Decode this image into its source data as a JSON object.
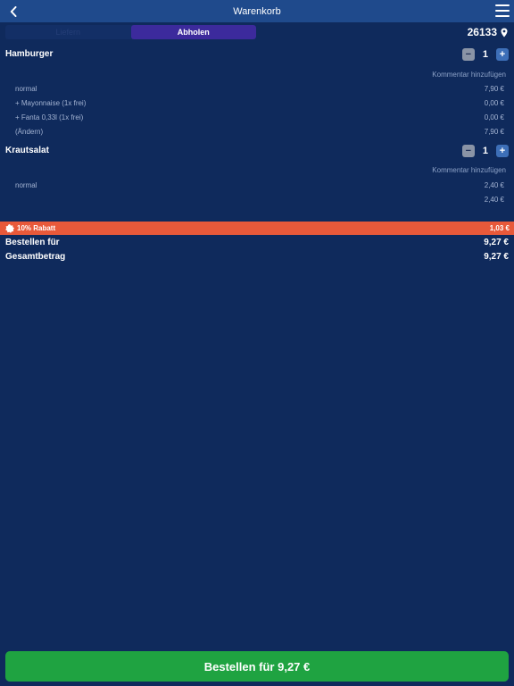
{
  "colors": {
    "background": "#0f2a5c",
    "navbar": "#1f4a8c",
    "segment_active": "#3c2a9c",
    "discount_bar": "#e8593a",
    "order_button": "#1fa341"
  },
  "header": {
    "title": "Warenkorb",
    "back_icon": "chevron-left-icon",
    "menu_icon": "hamburger-menu-icon"
  },
  "mode_tabs": [
    {
      "label": "Liefern",
      "active": false
    },
    {
      "label": "Abholen",
      "active": true
    }
  ],
  "location": {
    "zip": "26133",
    "icon": "map-pin-icon"
  },
  "cart_items": [
    {
      "name": "Hamburger",
      "quantity": "1",
      "comment_link": "Kommentar hinzufügen",
      "lines": [
        {
          "label": "normal",
          "price": "7,90 €"
        },
        {
          "label": "+ Mayonnaise (1x frei)",
          "price": "0,00 €"
        },
        {
          "label": "+ Fanta 0,33l (1x frei)",
          "price": "0,00 €"
        },
        {
          "label": "(Ändern)",
          "price": "7,90 €"
        }
      ]
    },
    {
      "name": "Krautsalat",
      "quantity": "1",
      "comment_link": "Kommentar hinzufügen",
      "lines": [
        {
          "label": "normal",
          "price": "2,40 €"
        }
      ],
      "subtotal": "2,40 €"
    }
  ],
  "discount": {
    "label": "10% Rabatt",
    "amount": "1,03 €",
    "icon": "discount-badge-icon"
  },
  "totals": {
    "order_for_label": "Bestellen für",
    "order_for_value": "9,27 €",
    "total_label": "Gesamtbetrag",
    "total_value": "9,27 €"
  },
  "order_button": {
    "label": "Bestellen für 9,27 €"
  }
}
